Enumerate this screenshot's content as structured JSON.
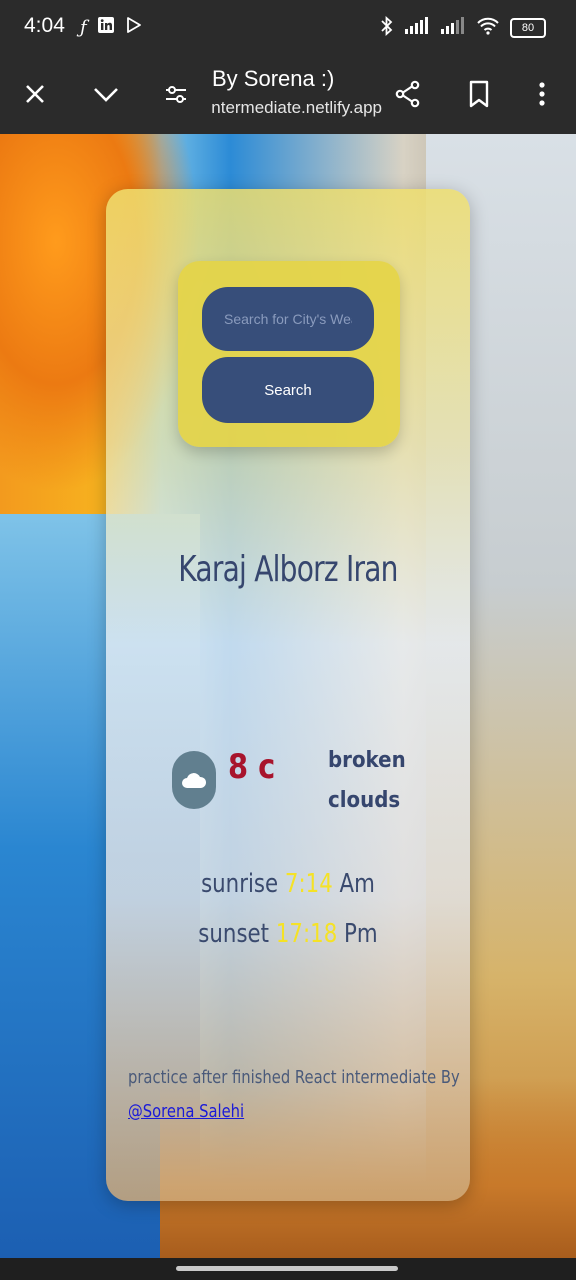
{
  "status_bar": {
    "time": "4:04",
    "battery": "80",
    "icons": [
      "facebook-icon",
      "linkedin-icon",
      "play-store-icon",
      "bluetooth-icon",
      "signal-icon",
      "wifi-icon",
      "battery-icon"
    ]
  },
  "toolbar": {
    "title": "By Sorena :)",
    "url": "react-intermediate.netlify.app",
    "icons": [
      "close-icon",
      "chevron-down-icon",
      "page-settings-icon",
      "share-icon",
      "bookmark-icon",
      "more-vert-icon"
    ]
  },
  "search": {
    "placeholder": "Search for City's Weather",
    "button_label": "Search"
  },
  "weather": {
    "city": "Karaj Alborz Iran",
    "temperature": "8 c",
    "description_line1": "broken",
    "description_line2": "clouds",
    "icon": "cloud-icon",
    "sunrise_label": "sunrise",
    "sunrise_time": "7:14",
    "sunrise_suffix": "Am",
    "sunset_label": "sunset",
    "sunset_time": "17:18",
    "sunset_suffix": "Pm"
  },
  "footer": {
    "text": "practice after finished React intermediate By",
    "link_label": "@Sorena Salehi"
  },
  "colors": {
    "accent": "#374e7a",
    "temperature": "#a8142c",
    "sun_time": "#f5e226",
    "link": "#1a1ad8"
  }
}
